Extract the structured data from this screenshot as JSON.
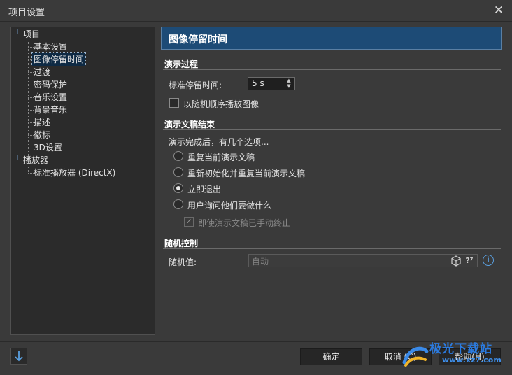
{
  "window": {
    "title": "项目设置"
  },
  "tree": {
    "root1": "项目",
    "items": [
      "基本设置",
      "图像停留时间",
      "过渡",
      "密码保护",
      "音乐设置",
      "背景音乐",
      "描述",
      "徽标",
      "3D设置"
    ],
    "root2": "播放器",
    "player_items": [
      "标准播放器 (DirectX)"
    ]
  },
  "panel": {
    "title": "图像停留时间",
    "section1": {
      "title": "演示过程",
      "duration_label": "标准停留时间:",
      "duration_value": "5 s",
      "random_order_label": "以随机顺序播放图像"
    },
    "section2": {
      "title": "演示文稿结束",
      "intro": "演示完成后，有几个选项...",
      "options": [
        "重复当前演示文稿",
        "重新初始化并重复当前演示文稿",
        "立即退出",
        "用户询问他们要做什么"
      ],
      "selected_index": 2,
      "manual_end_label": "即使演示文稿已手动终止"
    },
    "section3": {
      "title": "随机控制",
      "random_label": "随机值:",
      "random_placeholder": "自动"
    }
  },
  "buttons": {
    "ok": "确定",
    "cancel": "取消 (C)",
    "help": "帮助(H)"
  },
  "watermark": {
    "main": "极光下载站",
    "sub": "www.xz7.com"
  },
  "colors": {
    "accent": "#1d4b76",
    "selection": "#0e2a44",
    "info": "#5aa0e0"
  }
}
